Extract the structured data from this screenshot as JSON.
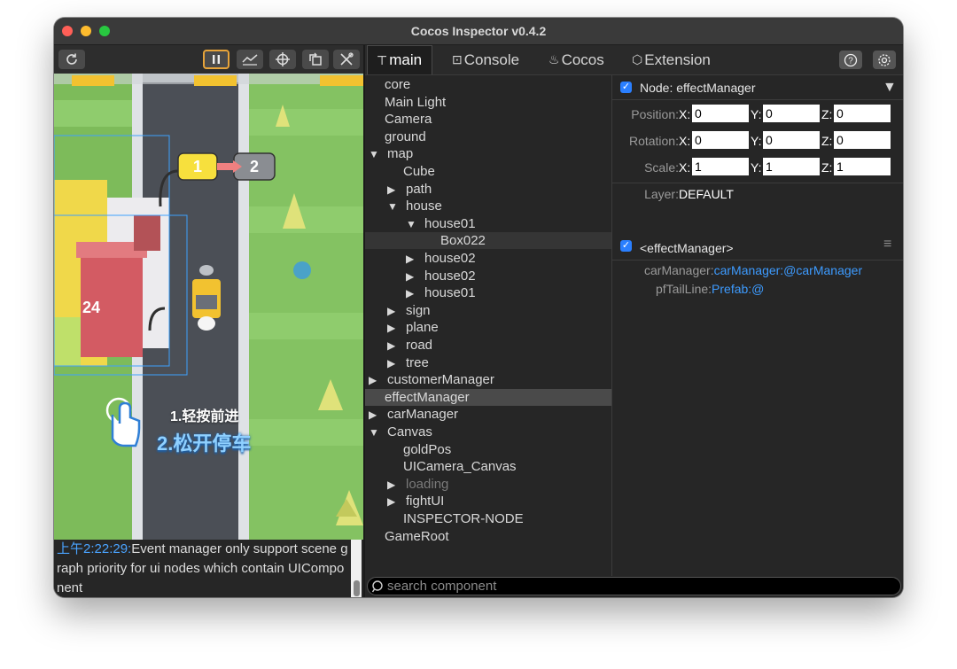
{
  "window": {
    "title": "Cocos Inspector v0.4.2"
  },
  "game": {
    "marker_1": "1",
    "marker_2": "2",
    "building_number": "24",
    "tutorial_line1": "1.轻按前进",
    "tutorial_line2": "2.松开停车"
  },
  "log": {
    "time": "上午2:22:29:",
    "message": "Event manager only support scene graph priority for ui nodes which contain UIComponent"
  },
  "tabs": [
    {
      "label": "main",
      "icon": "tree-icon"
    },
    {
      "label": "Console",
      "icon": "console-icon"
    },
    {
      "label": "Cocos",
      "icon": "flame-icon"
    },
    {
      "label": "Extension",
      "icon": "cube-icon"
    }
  ],
  "tree": [
    {
      "label": "core",
      "indent": 0,
      "arrow": ""
    },
    {
      "label": "Main Light",
      "indent": 0,
      "arrow": ""
    },
    {
      "label": "Camera",
      "indent": 0,
      "arrow": ""
    },
    {
      "label": "ground",
      "indent": 0,
      "arrow": ""
    },
    {
      "label": "map",
      "indent": 0,
      "arrow": "▼"
    },
    {
      "label": "Cube",
      "indent": 1,
      "arrow": ""
    },
    {
      "label": "path",
      "indent": 1,
      "arrow": "▶"
    },
    {
      "label": "house",
      "indent": 1,
      "arrow": "▼"
    },
    {
      "label": "house01",
      "indent": 2,
      "arrow": "▼"
    },
    {
      "label": "Box022",
      "indent": 3,
      "arrow": ""
    },
    {
      "label": "house02",
      "indent": 2,
      "arrow": "▶"
    },
    {
      "label": "house02",
      "indent": 2,
      "arrow": "▶"
    },
    {
      "label": "house01",
      "indent": 2,
      "arrow": "▶"
    },
    {
      "label": "sign",
      "indent": 1,
      "arrow": "▶"
    },
    {
      "label": "plane",
      "indent": 1,
      "arrow": "▶"
    },
    {
      "label": "road",
      "indent": 1,
      "arrow": "▶"
    },
    {
      "label": "tree",
      "indent": 1,
      "arrow": "▶"
    },
    {
      "label": "customerManager",
      "indent": 0,
      "arrow": "▶"
    },
    {
      "label": "effectManager",
      "indent": 0,
      "arrow": ""
    },
    {
      "label": "carManager",
      "indent": 0,
      "arrow": "▶"
    },
    {
      "label": "Canvas",
      "indent": 0,
      "arrow": "▼"
    },
    {
      "label": "goldPos",
      "indent": 1,
      "arrow": ""
    },
    {
      "label": "UICamera_Canvas",
      "indent": 1,
      "arrow": ""
    },
    {
      "label": "loading",
      "indent": 1,
      "arrow": "▶"
    },
    {
      "label": "fightUI",
      "indent": 1,
      "arrow": "▶"
    },
    {
      "label": "INSPECTOR-NODE",
      "indent": 1,
      "arrow": ""
    },
    {
      "label": "GameRoot",
      "indent": 0,
      "arrow": ""
    }
  ],
  "node": {
    "header": "Node: effectManager",
    "position_label": "Position:",
    "rotation_label": "Rotation:",
    "scale_label": "Scale:",
    "axis_x": "X:",
    "axis_y": "Y:",
    "axis_z": "Z:",
    "position": {
      "x": "0",
      "y": "0",
      "z": "0"
    },
    "rotation": {
      "x": "0",
      "y": "0",
      "z": "0"
    },
    "scale": {
      "x": "1",
      "y": "1",
      "z": "1"
    },
    "layer_label": "Layer:",
    "layer_value": "DEFAULT"
  },
  "component": {
    "header": "<effectManager>",
    "prop1_label": "carManager:",
    "prop1_value": "carManager:@carManager",
    "prop2_label": "pfTailLine:",
    "prop2_value": "Prefab:@"
  },
  "search": {
    "placeholder": "search component"
  },
  "colors": {
    "accent": "#3d9bff",
    "selected_row": "#4a4a4a",
    "pause_border": "#e7a43a"
  }
}
